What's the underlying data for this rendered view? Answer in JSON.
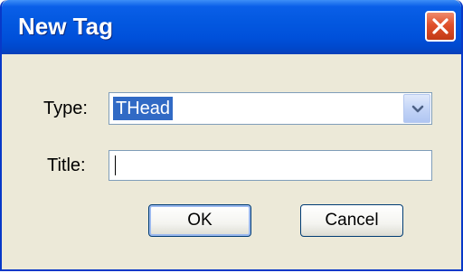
{
  "window": {
    "title": "New Tag",
    "close_icon": "close-icon"
  },
  "form": {
    "type_label": "Type:",
    "type_value": "THead",
    "dropdown_icon": "chevron-down-icon",
    "title_label": "Title:",
    "title_value": ""
  },
  "buttons": {
    "ok_label": "OK",
    "cancel_label": "Cancel"
  },
  "colors": {
    "titlebar": "#0050da",
    "close_button": "#e0502b",
    "dialog_background": "#ece9d8",
    "selection": "#316ac5"
  }
}
